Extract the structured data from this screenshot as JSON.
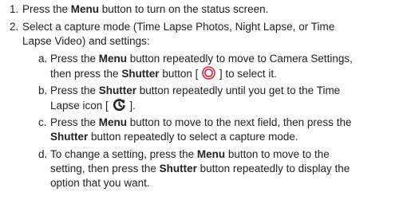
{
  "instructions": {
    "step1": {
      "number": "1.",
      "text_a": "Press the ",
      "bold_a": "Menu",
      "text_b": " button to turn on the status screen."
    },
    "step2": {
      "number": "2.",
      "line1": "Select a capture mode  (Time Lapse Photos, Night Lapse, or Time",
      "line2": "Lapse Video) and settings:",
      "sub_a": {
        "letter": "a.",
        "l1_text_a": "Press the ",
        "l1_bold_a": "Menu",
        "l1_text_b": " button repeatedly to move to Camera Settings,",
        "l2_text_a": "then press the ",
        "l2_bold_a": "Shutter",
        "l2_text_b": " button [ ",
        "l2_text_c": " ] to select it.",
        "icon": "shutter-button-icon"
      },
      "sub_b": {
        "letter": "b.",
        "l1_text_a": "Press the ",
        "l1_bold_a": "Shutter",
        "l1_text_b": " button repeatedly until you get to the Time",
        "l2_text_a": "Lapse icon [ ",
        "l2_text_b": " ].",
        "icon": "time-lapse-icon"
      },
      "sub_c": {
        "letter": "c.",
        "l1_text_a": "Press the ",
        "l1_bold_a": "Menu",
        "l1_text_b": " button to move to the next field, then press the",
        "l2_bold_a": "Shutter",
        "l2_text_a": " button repeatedly to select a capture mode."
      },
      "sub_d": {
        "letter": "d.",
        "l1_text_a": "To change a setting, press the ",
        "l1_bold_a": "Menu",
        "l1_text_b": " button to move to the",
        "l2_text_a": "setting, then press the ",
        "l2_bold_a": "Shutter",
        "l2_text_b": " button repeatedly to display the",
        "l3_text_a": "option that you want."
      }
    }
  }
}
